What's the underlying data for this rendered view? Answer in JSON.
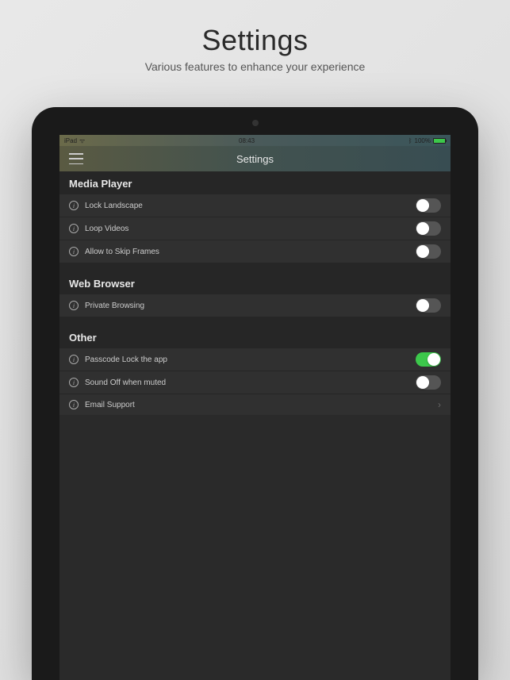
{
  "header": {
    "title": "Settings",
    "subtitle": "Various features to enhance your experience"
  },
  "status_bar": {
    "carrier": "iPad",
    "time": "08:43",
    "battery_pct": "100%",
    "bluetooth": true
  },
  "nav": {
    "title": "Settings"
  },
  "sections": [
    {
      "title": "Media Player",
      "rows": [
        {
          "label": "Lock Landscape",
          "type": "toggle",
          "value": false
        },
        {
          "label": "Loop Videos",
          "type": "toggle",
          "value": false
        },
        {
          "label": "Allow to Skip Frames",
          "type": "toggle",
          "value": false
        }
      ]
    },
    {
      "title": "Web Browser",
      "rows": [
        {
          "label": "Private Browsing",
          "type": "toggle",
          "value": false
        }
      ]
    },
    {
      "title": "Other",
      "rows": [
        {
          "label": "Passcode Lock the app",
          "type": "toggle",
          "value": true
        },
        {
          "label": "Sound Off when muted",
          "type": "toggle",
          "value": false
        },
        {
          "label": "Email Support",
          "type": "disclosure"
        }
      ]
    }
  ]
}
